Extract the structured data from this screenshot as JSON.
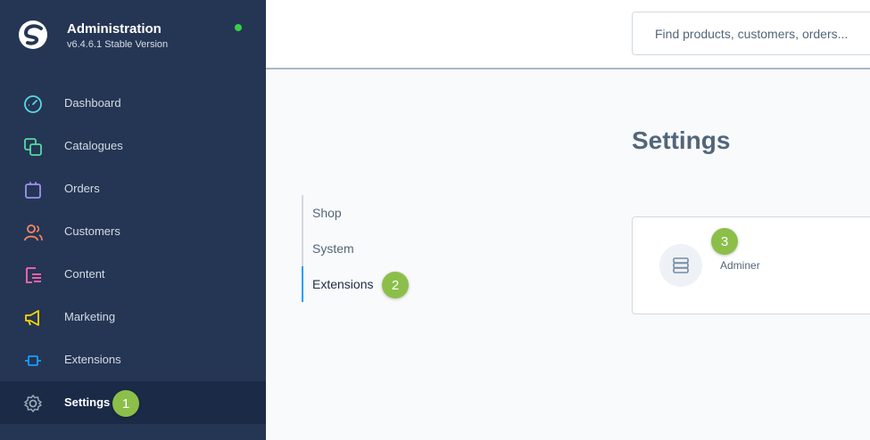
{
  "sidebar": {
    "title": "Administration",
    "version": "v6.4.6.1 Stable Version",
    "status_color": "#37d046",
    "items": [
      {
        "label": "Dashboard",
        "icon": "dashboard-icon",
        "color": "#57d9ea"
      },
      {
        "label": "Catalogues",
        "icon": "catalogues-icon",
        "color": "#57d9a3"
      },
      {
        "label": "Orders",
        "icon": "orders-icon",
        "color": "#a092f0"
      },
      {
        "label": "Customers",
        "icon": "customers-icon",
        "color": "#f88962"
      },
      {
        "label": "Content",
        "icon": "content-icon",
        "color": "#ff68b4"
      },
      {
        "label": "Marketing",
        "icon": "marketing-icon",
        "color": "#ffd700"
      },
      {
        "label": "Extensions",
        "icon": "extensions-icon",
        "color": "#189eff"
      },
      {
        "label": "Settings",
        "icon": "settings-icon",
        "color": "#9aa8b5",
        "active": true
      }
    ]
  },
  "header": {
    "search_placeholder": "Find products, customers, orders..."
  },
  "main": {
    "title": "Settings",
    "tabs": [
      {
        "label": "Shop"
      },
      {
        "label": "System"
      },
      {
        "label": "Extensions",
        "active": true
      }
    ],
    "extensions": [
      {
        "label": "Adminer",
        "icon": "database-icon"
      }
    ]
  },
  "badges": {
    "one": "1",
    "two": "2",
    "three": "3",
    "color": "#8cbf4a"
  },
  "colors": {
    "sidebar_bg": "#253654",
    "accent": "#189eff",
    "text_muted": "#52667a"
  }
}
